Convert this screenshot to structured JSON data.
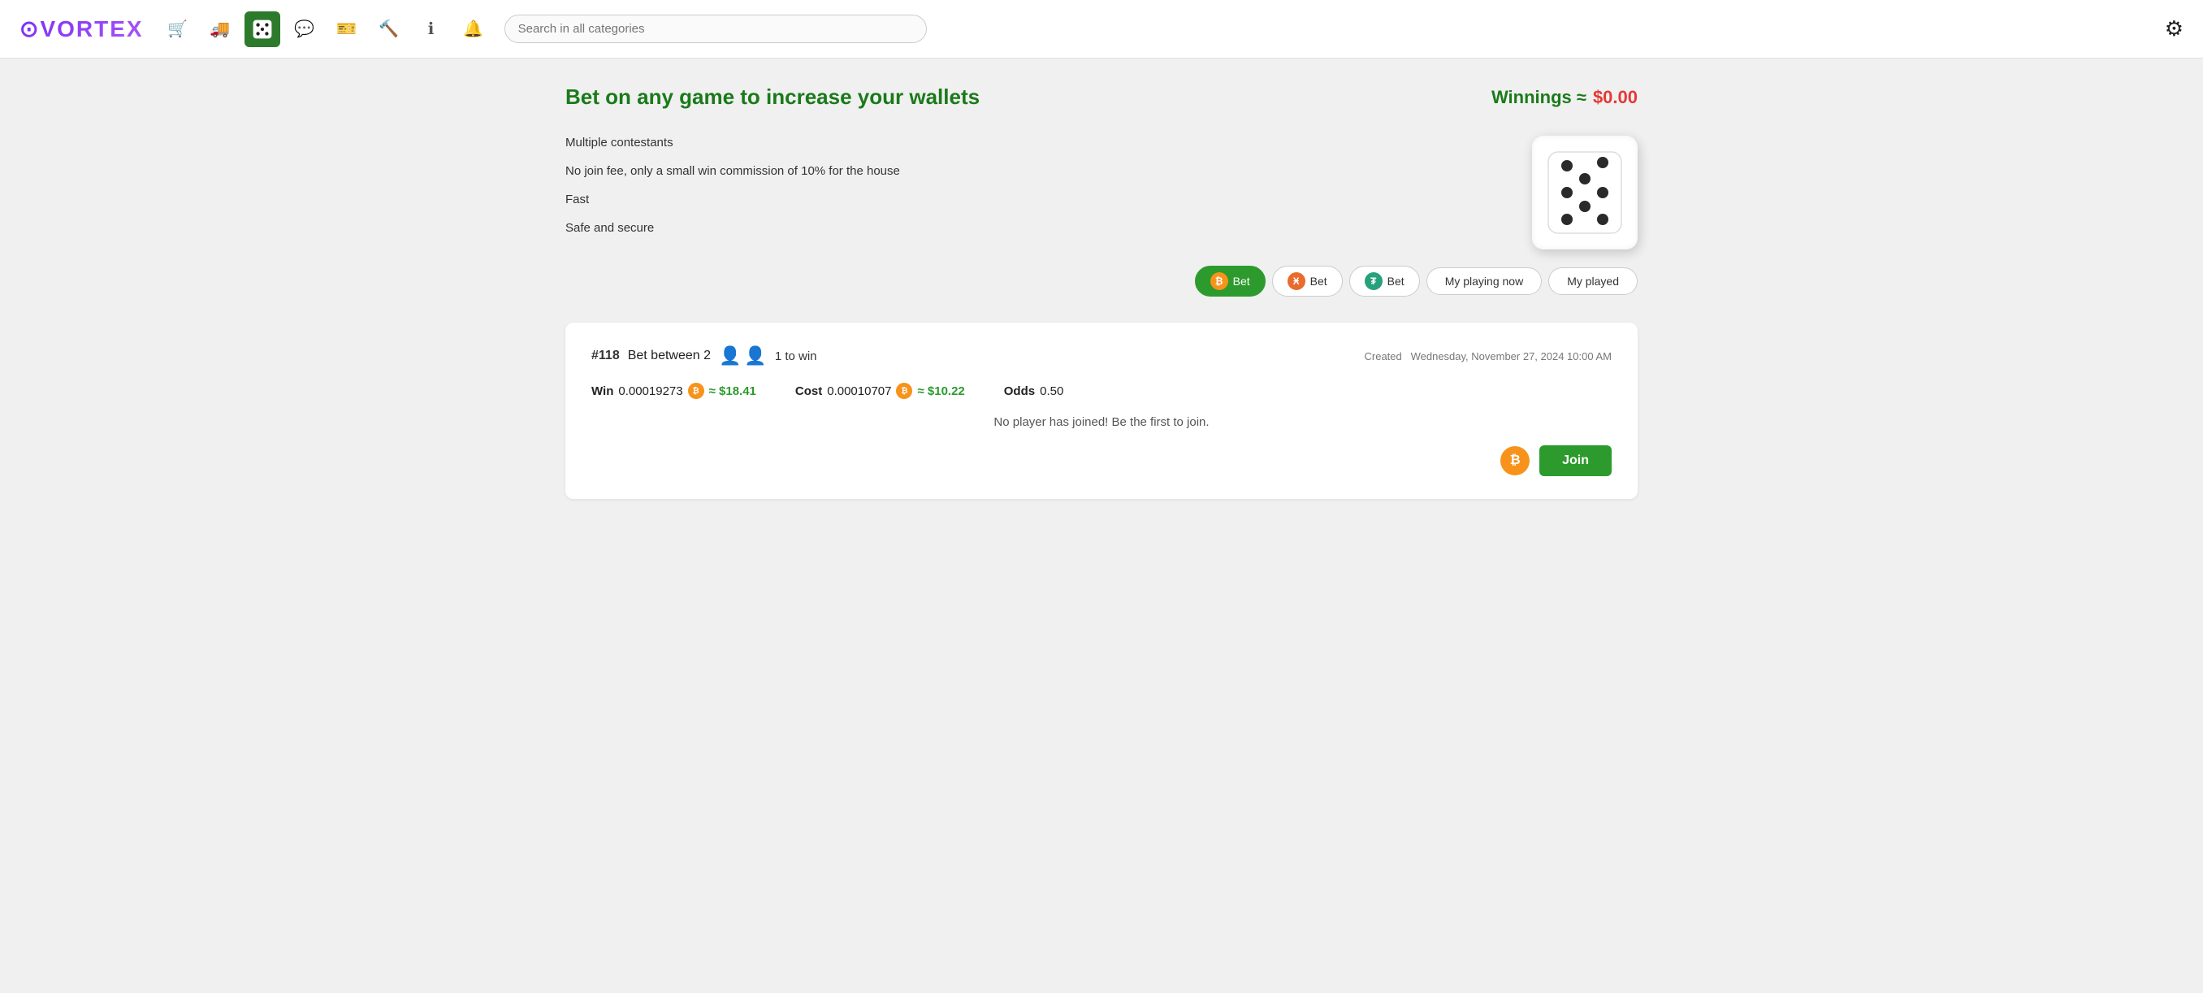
{
  "logo": {
    "text": "VORTEX"
  },
  "header": {
    "search_placeholder": "Search in all categories",
    "icons": [
      {
        "name": "cart-icon",
        "symbol": "🛒"
      },
      {
        "name": "delivery-icon",
        "symbol": "🚚"
      },
      {
        "name": "dice-icon",
        "symbol": "🎲"
      },
      {
        "name": "chat-icon",
        "symbol": "💬"
      },
      {
        "name": "ticket-icon",
        "symbol": "🎫"
      },
      {
        "name": "hammer-icon",
        "symbol": "🔨"
      },
      {
        "name": "info-icon",
        "symbol": "ℹ"
      },
      {
        "name": "bell-icon",
        "symbol": "🔔"
      }
    ]
  },
  "page": {
    "title": "Bet on any game to increase your wallets",
    "winnings_label": "Winnings ≈",
    "winnings_value": "$0.00"
  },
  "features": [
    "Multiple contestants",
    "No join fee, only a small win commission of 10% for the house",
    "Fast",
    "Safe and secure"
  ],
  "tabs": [
    {
      "id": "btc-bet",
      "label": "Bet",
      "crypto": "BTC",
      "active": true
    },
    {
      "id": "xmr-bet",
      "label": "Bet",
      "crypto": "XMR",
      "active": false
    },
    {
      "id": "usdt-bet",
      "label": "Bet",
      "crypto": "USDT",
      "active": false
    },
    {
      "id": "my-playing-now",
      "label": "My playing now",
      "active": false
    },
    {
      "id": "my-played",
      "label": "My played",
      "active": false
    }
  ],
  "game": {
    "id": "#118",
    "description": "Bet between 2",
    "to_win": "1 to win",
    "created_label": "Created",
    "created_date": "Wednesday, November 27, 2024 10:00 AM",
    "win_label": "Win",
    "win_amount": "0.00019273",
    "win_usd": "≈ $18.41",
    "cost_label": "Cost",
    "cost_amount": "0.00010707",
    "cost_usd": "≈ $10.22",
    "odds_label": "Odds",
    "odds_value": "0.50",
    "no_player_msg": "No player has joined! Be the first to join.",
    "join_label": "Join"
  }
}
